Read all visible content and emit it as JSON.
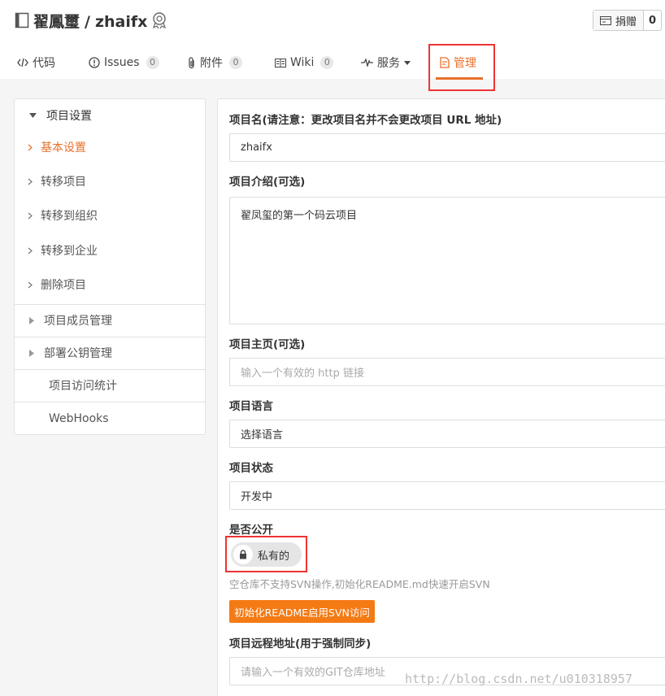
{
  "header": {
    "owner": "翟鳳璽",
    "separator": "/",
    "repo": "zhaifx",
    "donate_label": "捐赠",
    "donate_count": "0"
  },
  "tabs": [
    {
      "label": "代码",
      "icon": "code-icon"
    },
    {
      "label": "Issues",
      "count": "0",
      "icon": "issue-icon"
    },
    {
      "label": "附件",
      "count": "0",
      "icon": "attachment-icon"
    },
    {
      "label": "Wiki",
      "count": "0",
      "icon": "book-icon"
    },
    {
      "label": "服务",
      "icon": "pulse-icon"
    },
    {
      "label": "管理",
      "icon": "doc-icon",
      "active": true
    }
  ],
  "sidebar": {
    "section_title": "项目设置",
    "items": [
      "基本设置",
      "转移项目",
      "转移到组织",
      "转移到企业",
      "删除项目"
    ],
    "groups": [
      "项目成员管理",
      "部署公钥管理"
    ],
    "plain": [
      "项目访问统计",
      "WebHooks"
    ]
  },
  "form": {
    "name_label": "项目名(请注意：更改项目名并不会更改项目 URL 地址)",
    "name_value": "zhaifx",
    "intro_label": "项目介绍(可选)",
    "intro_value": "翟凤玺的第一个码云项目",
    "homepage_label": "项目主页(可选)",
    "homepage_placeholder": "输入一个有效的 http 链接",
    "language_label": "项目语言",
    "language_value": "选择语言",
    "status_label": "项目状态",
    "status_value": "开发中",
    "public_label": "是否公开",
    "public_toggle": "私有的",
    "svn_hint": "空仓库不支持SVN操作,初始化README.md快速开启SVN",
    "svn_button": "初始化README启用SVN访问",
    "remote_label": "项目远程地址(用于强制同步)",
    "remote_placeholder": "请输入一个有效的GIT仓库地址"
  },
  "watermark": "http://blog.csdn.net/u010318957",
  "colors": {
    "accent": "#e8702a",
    "button": "#f47a14",
    "highlight_box": "#e33333"
  }
}
